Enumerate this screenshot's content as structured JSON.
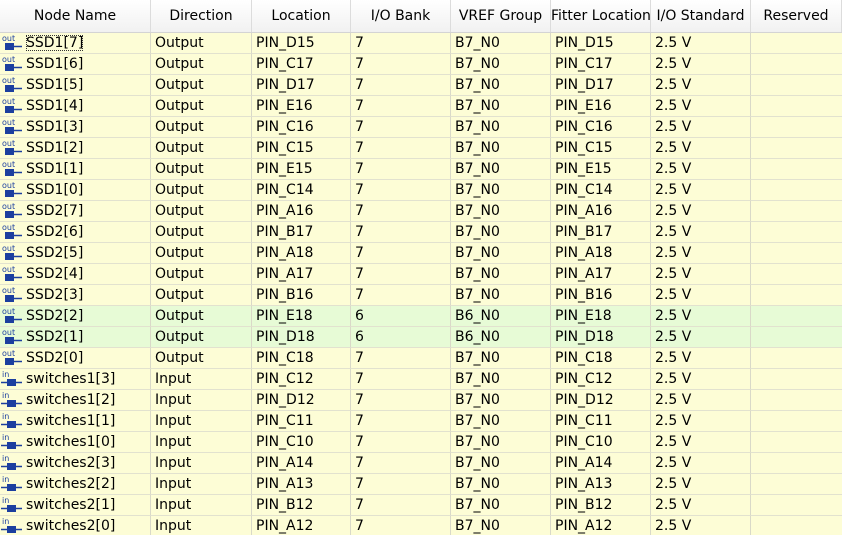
{
  "columns": [
    "Node Name",
    "Direction",
    "Location",
    "I/O Bank",
    "VREF Group",
    "Fitter Location",
    "I/O Standard",
    "Reserved"
  ],
  "icon_labels": {
    "out": "out",
    "in": "in"
  },
  "colors": {
    "row_default": "#fdfdd6",
    "row_bank6": "#e7fbd6",
    "icon_blue": "#1c3f9f"
  },
  "rows": [
    {
      "icon": "out",
      "name": "SSD1[7]",
      "direction": "Output",
      "location": "PIN_D15",
      "bank": "7",
      "vref": "B7_N0",
      "fitter": "PIN_D15",
      "standard": "2.5 V",
      "reserved": "",
      "highlight": false
    },
    {
      "icon": "out",
      "name": "SSD1[6]",
      "direction": "Output",
      "location": "PIN_C17",
      "bank": "7",
      "vref": "B7_N0",
      "fitter": "PIN_C17",
      "standard": "2.5 V",
      "reserved": "",
      "highlight": false
    },
    {
      "icon": "out",
      "name": "SSD1[5]",
      "direction": "Output",
      "location": "PIN_D17",
      "bank": "7",
      "vref": "B7_N0",
      "fitter": "PIN_D17",
      "standard": "2.5 V",
      "reserved": "",
      "highlight": false
    },
    {
      "icon": "out",
      "name": "SSD1[4]",
      "direction": "Output",
      "location": "PIN_E16",
      "bank": "7",
      "vref": "B7_N0",
      "fitter": "PIN_E16",
      "standard": "2.5 V",
      "reserved": "",
      "highlight": false
    },
    {
      "icon": "out",
      "name": "SSD1[3]",
      "direction": "Output",
      "location": "PIN_C16",
      "bank": "7",
      "vref": "B7_N0",
      "fitter": "PIN_C16",
      "standard": "2.5 V",
      "reserved": "",
      "highlight": false
    },
    {
      "icon": "out",
      "name": "SSD1[2]",
      "direction": "Output",
      "location": "PIN_C15",
      "bank": "7",
      "vref": "B7_N0",
      "fitter": "PIN_C15",
      "standard": "2.5 V",
      "reserved": "",
      "highlight": false
    },
    {
      "icon": "out",
      "name": "SSD1[1]",
      "direction": "Output",
      "location": "PIN_E15",
      "bank": "7",
      "vref": "B7_N0",
      "fitter": "PIN_E15",
      "standard": "2.5 V",
      "reserved": "",
      "highlight": false
    },
    {
      "icon": "out",
      "name": "SSD1[0]",
      "direction": "Output",
      "location": "PIN_C14",
      "bank": "7",
      "vref": "B7_N0",
      "fitter": "PIN_C14",
      "standard": "2.5 V",
      "reserved": "",
      "highlight": false
    },
    {
      "icon": "out",
      "name": "SSD2[7]",
      "direction": "Output",
      "location": "PIN_A16",
      "bank": "7",
      "vref": "B7_N0",
      "fitter": "PIN_A16",
      "standard": "2.5 V",
      "reserved": "",
      "highlight": false
    },
    {
      "icon": "out",
      "name": "SSD2[6]",
      "direction": "Output",
      "location": "PIN_B17",
      "bank": "7",
      "vref": "B7_N0",
      "fitter": "PIN_B17",
      "standard": "2.5 V",
      "reserved": "",
      "highlight": false
    },
    {
      "icon": "out",
      "name": "SSD2[5]",
      "direction": "Output",
      "location": "PIN_A18",
      "bank": "7",
      "vref": "B7_N0",
      "fitter": "PIN_A18",
      "standard": "2.5 V",
      "reserved": "",
      "highlight": false
    },
    {
      "icon": "out",
      "name": "SSD2[4]",
      "direction": "Output",
      "location": "PIN_A17",
      "bank": "7",
      "vref": "B7_N0",
      "fitter": "PIN_A17",
      "standard": "2.5 V",
      "reserved": "",
      "highlight": false
    },
    {
      "icon": "out",
      "name": "SSD2[3]",
      "direction": "Output",
      "location": "PIN_B16",
      "bank": "7",
      "vref": "B7_N0",
      "fitter": "PIN_B16",
      "standard": "2.5 V",
      "reserved": "",
      "highlight": false
    },
    {
      "icon": "out",
      "name": "SSD2[2]",
      "direction": "Output",
      "location": "PIN_E18",
      "bank": "6",
      "vref": "B6_N0",
      "fitter": "PIN_E18",
      "standard": "2.5 V",
      "reserved": "",
      "highlight": true
    },
    {
      "icon": "out",
      "name": "SSD2[1]",
      "direction": "Output",
      "location": "PIN_D18",
      "bank": "6",
      "vref": "B6_N0",
      "fitter": "PIN_D18",
      "standard": "2.5 V",
      "reserved": "",
      "highlight": true
    },
    {
      "icon": "out",
      "name": "SSD2[0]",
      "direction": "Output",
      "location": "PIN_C18",
      "bank": "7",
      "vref": "B7_N0",
      "fitter": "PIN_C18",
      "standard": "2.5 V",
      "reserved": "",
      "highlight": false
    },
    {
      "icon": "in",
      "name": "switches1[3]",
      "direction": "Input",
      "location": "PIN_C12",
      "bank": "7",
      "vref": "B7_N0",
      "fitter": "PIN_C12",
      "standard": "2.5 V",
      "reserved": "",
      "highlight": false
    },
    {
      "icon": "in",
      "name": "switches1[2]",
      "direction": "Input",
      "location": "PIN_D12",
      "bank": "7",
      "vref": "B7_N0",
      "fitter": "PIN_D12",
      "standard": "2.5 V",
      "reserved": "",
      "highlight": false
    },
    {
      "icon": "in",
      "name": "switches1[1]",
      "direction": "Input",
      "location": "PIN_C11",
      "bank": "7",
      "vref": "B7_N0",
      "fitter": "PIN_C11",
      "standard": "2.5 V",
      "reserved": "",
      "highlight": false
    },
    {
      "icon": "in",
      "name": "switches1[0]",
      "direction": "Input",
      "location": "PIN_C10",
      "bank": "7",
      "vref": "B7_N0",
      "fitter": "PIN_C10",
      "standard": "2.5 V",
      "reserved": "",
      "highlight": false
    },
    {
      "icon": "in",
      "name": "switches2[3]",
      "direction": "Input",
      "location": "PIN_A14",
      "bank": "7",
      "vref": "B7_N0",
      "fitter": "PIN_A14",
      "standard": "2.5 V",
      "reserved": "",
      "highlight": false
    },
    {
      "icon": "in",
      "name": "switches2[2]",
      "direction": "Input",
      "location": "PIN_A13",
      "bank": "7",
      "vref": "B7_N0",
      "fitter": "PIN_A13",
      "standard": "2.5 V",
      "reserved": "",
      "highlight": false
    },
    {
      "icon": "in",
      "name": "switches2[1]",
      "direction": "Input",
      "location": "PIN_B12",
      "bank": "7",
      "vref": "B7_N0",
      "fitter": "PIN_B12",
      "standard": "2.5 V",
      "reserved": "",
      "highlight": false
    },
    {
      "icon": "in",
      "name": "switches2[0]",
      "direction": "Input",
      "location": "PIN_A12",
      "bank": "7",
      "vref": "B7_N0",
      "fitter": "PIN_A12",
      "standard": "2.5 V",
      "reserved": "",
      "highlight": false
    }
  ]
}
